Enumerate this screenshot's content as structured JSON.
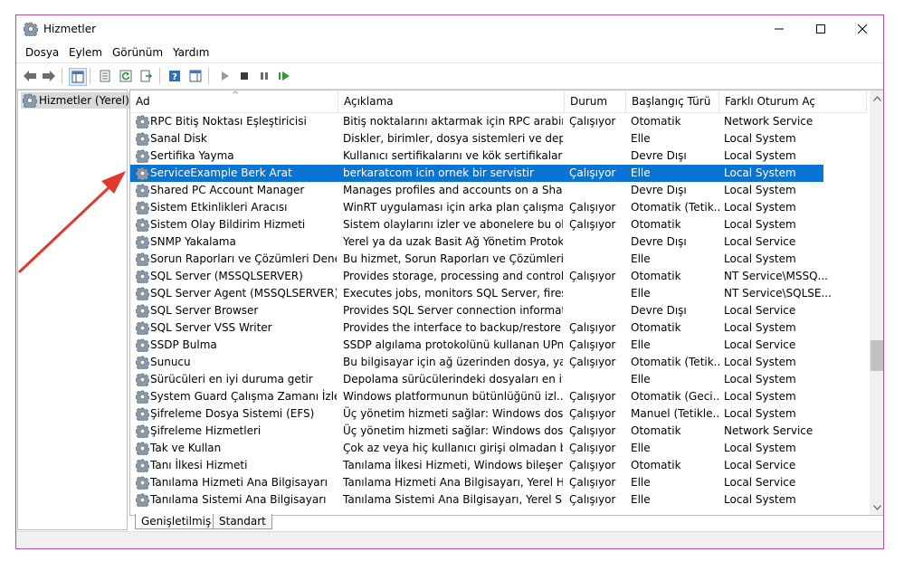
{
  "window": {
    "title": "Hizmetler"
  },
  "menu": [
    "Dosya",
    "Eylem",
    "Görünüm",
    "Yardım"
  ],
  "toolbar": [
    "back-icon",
    "forward-icon",
    "console-tree-icon",
    "properties-icon",
    "refresh-icon",
    "export-icon",
    "help-icon",
    "show-pane-icon",
    "start-icon",
    "stop-icon",
    "pause-icon",
    "restart-icon"
  ],
  "tree": {
    "root": "Hizmetler (Yerel)"
  },
  "columns": [
    "Ad",
    "Açıklama",
    "Durum",
    "Başlangıç Türü",
    "Farklı Oturum Aç"
  ],
  "rows": [
    [
      "RPC Bitiş Noktası Eşleştiricisi",
      "Bitiş noktalarını aktarmak için RPC arabirim...",
      "Çalışıyor",
      "Otomatik",
      "Network Service"
    ],
    [
      "Sanal Disk",
      "Diskler, birimler, dosya sistemleri ve depola...",
      "",
      "Elle",
      "Local System"
    ],
    [
      "Sertifika Yayma",
      "Kullanıcı sertifikalarını ve kök sertifikalarını ...",
      "",
      "Devre Dışı",
      "Local System"
    ],
    [
      "ServiceExample Berk Arat",
      "berkaratcom icin ornek bir servistir",
      "Çalışıyor",
      "Elle",
      "Local System"
    ],
    [
      "Shared PC Account Manager",
      "Manages profiles and accounts on a Shared...",
      "",
      "Devre Dışı",
      "Local System"
    ],
    [
      "Sistem Etkinlikleri Aracısı",
      "WinRT uygulaması için arka plan çalışmasın...",
      "Çalışıyor",
      "Otomatik (Tetik...",
      "Local System"
    ],
    [
      "Sistem Olay Bildirim Hizmeti",
      "Sistem olaylarını izler ve abonelere bu olayl...",
      "Çalışıyor",
      "Otomatik",
      "Local System"
    ],
    [
      "SNMP Yakalama",
      "Yerel ya da uzak Basit Ağ Yönetim Protokol...",
      "",
      "Devre Dışı",
      "Local Service"
    ],
    [
      "Sorun Raporları ve Çözümleri Deneti...",
      "Bu hizmet, Sorun Raporları ve Çözümleri de...",
      "",
      "Elle",
      "Local System"
    ],
    [
      "SQL Server (MSSQLSERVER)",
      "Provides storage, processing and controlle...",
      "Çalışıyor",
      "Otomatik",
      "NT Service\\MSSQ..."
    ],
    [
      "SQL Server Agent (MSSQLSERVER)",
      "Executes jobs, monitors SQL Server, fires ale...",
      "",
      "Elle",
      "NT Service\\SQLSE..."
    ],
    [
      "SQL Server Browser",
      "Provides SQL Server connection informatio...",
      "",
      "Devre Dışı",
      "Local Service"
    ],
    [
      "SQL Server VSS Writer",
      "Provides the interface to backup/restore Mi...",
      "Çalışıyor",
      "Otomatik",
      "Local System"
    ],
    [
      "SSDP Bulma",
      "SSDP algılama protokolünü kullanan UPnP ...",
      "Çalışıyor",
      "Elle",
      "Local Service"
    ],
    [
      "Sunucu",
      "Bu bilgisayar için ağ üzerinden dosya, yazıcı...",
      "Çalışıyor",
      "Otomatik (Tetik...",
      "Local System"
    ],
    [
      "Sürücüleri en iyi duruma getir",
      "Depolama sürücülerindeki dosyaları en iyi d...",
      "",
      "Elle",
      "Local System"
    ],
    [
      "System Guard Çalışma Zamanı İzleyi...",
      "Windows platformunun bütünlüğünü izl...",
      "Çalışıyor",
      "Otomatik (Geci...",
      "Local System"
    ],
    [
      "Şifreleme Dosya Sistemi (EFS)",
      "Üç yönetim hizmeti sağlar: Windows dosyal...",
      "Çalışıyor",
      "Manuel (Tetikle...",
      "Local System"
    ],
    [
      "Şifreleme Hizmetleri",
      "Üç yönetim hizmeti sağlar: Windows dosyal...",
      "Çalışıyor",
      "Otomatik",
      "Network Service"
    ],
    [
      "Tak ve Kullan",
      "Çok az veya hiç kullanıcı girişi olmadan bilg...",
      "Çalışıyor",
      "Elle",
      "Local System"
    ],
    [
      "Tanı İlkesi Hizmeti",
      "Tanılama İlkesi Hizmeti, Windows bileşenler...",
      "Çalışıyor",
      "Otomatik",
      "Local Service"
    ],
    [
      "Tanılama Hizmeti Ana Bilgisayarı",
      "Tanılama Hizmeti Ana Bilgisayarı, Yerel Hiz...",
      "Çalışıyor",
      "Elle",
      "Local Service"
    ],
    [
      "Tanılama Sistemi Ana Bilgisayarı",
      "Tanılama Sistemi Ana Bilgisayarı, Yerel Siste...",
      "Çalışıyor",
      "Elle",
      "Local System"
    ]
  ],
  "selected_row": 3,
  "tabs": [
    "Genişletilmiş",
    "Standart"
  ],
  "colors": {
    "selection": "#0a74d4",
    "annotation_arrow": "#e03a2e",
    "window_border": "#b04fa6"
  }
}
